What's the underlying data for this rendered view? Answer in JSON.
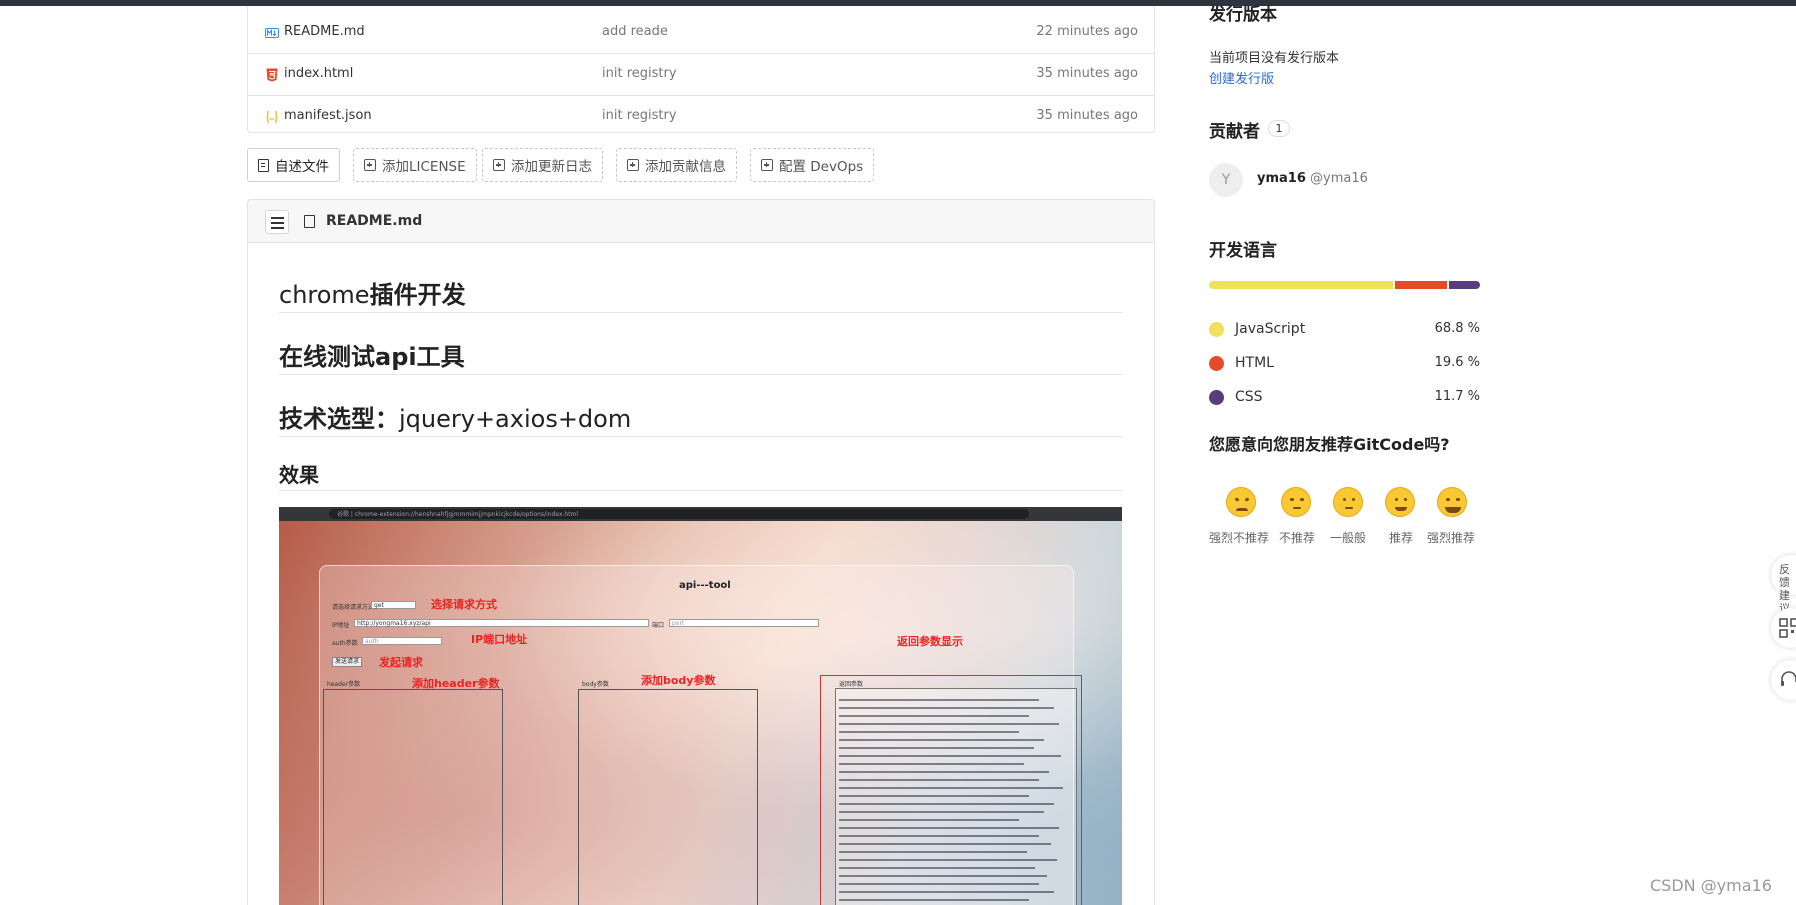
{
  "files": [
    {
      "name": "README.md",
      "message": "add reade",
      "time": "22 minutes ago",
      "icon": "markdown-icon",
      "color": "#3b8ae6"
    },
    {
      "name": "index.html",
      "message": "init registry",
      "time": "35 minutes ago",
      "icon": "html5-icon",
      "color": "#e44d26"
    },
    {
      "name": "manifest.json",
      "message": "init registry",
      "time": "35 minutes ago",
      "icon": "json-icon",
      "color": "#f0b429"
    }
  ],
  "quick_buttons": {
    "readme": "自述文件",
    "license": "添加LICENSE",
    "changelog": "添加更新日志",
    "contrib": "添加贡献信息",
    "devops": "配置 DevOps"
  },
  "readme": {
    "file_title": "README.md",
    "h1a_prefix": "chrome",
    "h1a_bold": "插件开发",
    "h1b": "在线测试api工具",
    "h1c_bold": "技术选型：",
    "h1c_rest": "jquery+axios+dom",
    "h2": "效果"
  },
  "screenshot": {
    "url": "谷歌 | chrome-extension://henshnahfjgjmmmimjjmpnkicjkcde/options/index.html",
    "app_title": "api---tool",
    "labels": {
      "method": "选择请求方式",
      "ip": "IP端口地址",
      "send": "发起请求",
      "header": "添加header参数",
      "body": "添加body参数",
      "response": "返回参数显示"
    },
    "form": {
      "method_label": "请选择请求方式",
      "method_value": "get",
      "url_label": "IP地址",
      "url_value": "http://yongma16.xyz/api",
      "port_label": "端口",
      "port_value": "port",
      "auth_label": "auth参数",
      "auth_value": "auth",
      "send_btn": "发送请求",
      "header_label": "header参数",
      "body_label": "body参数",
      "resp_label": "返回参数"
    }
  },
  "sidebar": {
    "release_head": "发行版本",
    "release_text": "当前项目没有发行版本",
    "release_link": "创建发行版",
    "contrib_head": "贡献者",
    "contrib_count": "1",
    "contributor": {
      "avatar": "Y",
      "name": "yma16",
      "handle": "@yma16"
    },
    "lang_head": "开发语言",
    "languages": [
      {
        "name": "JavaScript",
        "pct": "68.8 %",
        "value": 68.8,
        "color": "#f1e05a"
      },
      {
        "name": "HTML",
        "pct": "19.6 %",
        "value": 19.6,
        "color": "#e34c26"
      },
      {
        "name": "CSS",
        "pct": "11.7 %",
        "value": 11.7,
        "color": "#563d7c"
      }
    ],
    "rec_head": "您愿意向您朋友推荐GitCode吗?",
    "ratings": [
      "强烈不推荐",
      "不推荐",
      "一般般",
      "推荐",
      "强烈推荐"
    ]
  },
  "float": {
    "feedback": "反馈建议"
  },
  "watermark": "CSDN @yma16"
}
